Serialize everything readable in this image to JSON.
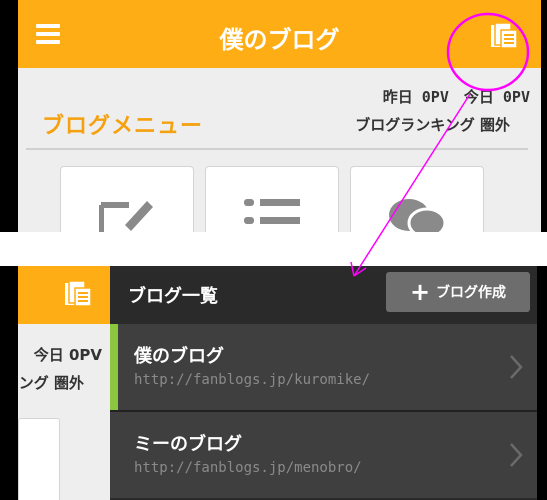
{
  "top": {
    "title": "僕のブログ",
    "menu_heading": "ブログメニュー",
    "stats_line1": "昨日 0PV　今日 0PV",
    "stats_line2": "ブログランキング 圏外"
  },
  "bottom": {
    "left": {
      "today": "今日 0PV",
      "ranking_partial": "ング 圏外"
    },
    "panel_title": "ブログ一覧",
    "create_button": "ブログ作成",
    "blogs": [
      {
        "name": "僕のブログ",
        "url": "http://fanblogs.jp/kuromike/"
      },
      {
        "name": "ミーのブログ",
        "url": "http://fanblogs.jp/menobro/"
      }
    ]
  },
  "colors": {
    "header": "#ffad14",
    "heading_orange": "#f5a10f",
    "annotation": "#ff00ff",
    "accent_green": "#8cc63f"
  }
}
